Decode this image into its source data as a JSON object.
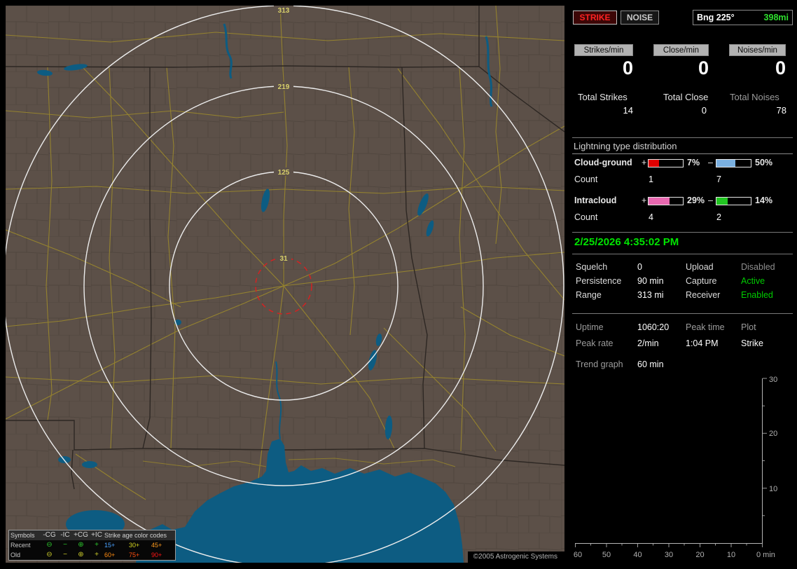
{
  "map": {
    "ring_labels": {
      "r313": "313",
      "r219": "219",
      "r125": "125",
      "r31": "31"
    },
    "copyright": "©2005 Astrogenic Systems",
    "legend": {
      "symbols_header": "Symbols",
      "columns": [
        "-CG",
        "-IC",
        "+CG",
        "+IC"
      ],
      "age_header": "Strike age color codes",
      "recent_label": "Recent",
      "old_label": "Old",
      "symbol_glyphs": [
        "⊖",
        "−",
        "⊕",
        "+"
      ],
      "recent_ages": [
        "15+",
        "30+",
        "45+"
      ],
      "old_ages": [
        "60+",
        "75+",
        "90+"
      ]
    }
  },
  "panel": {
    "strike_button": "STRIKE",
    "noise_button": "NOISE",
    "bearing": {
      "label": "Bng 225°",
      "value": "398mi"
    },
    "rates": {
      "chips": [
        "Strikes/min",
        "Close/min",
        "Noises/min"
      ],
      "values": [
        "0",
        "0",
        "0"
      ]
    },
    "totals": {
      "labels": [
        "Total Strikes",
        "Total Close",
        "Total Noises"
      ],
      "values": [
        "14",
        "0",
        "78"
      ]
    },
    "distribution": {
      "title": "Lightning type distribution",
      "cg": {
        "label": "Cloud-ground",
        "plus": "+",
        "plus_pct": "7%",
        "minus": "–",
        "minus_pct": "50%",
        "count_label": "Count",
        "plus_count": "1",
        "minus_count": "7"
      },
      "ic": {
        "label": "Intracloud",
        "plus": "+",
        "plus_pct": "29%",
        "minus": "–",
        "minus_pct": "14%",
        "count_label": "Count",
        "plus_count": "4",
        "minus_count": "2"
      }
    },
    "datetime": "2/25/2026 4:35:02 PM",
    "settings": {
      "rows": [
        {
          "l1": "Squelch",
          "v1": "0",
          "l2": "Upload",
          "v2": "Disabled",
          "state": "disabled"
        },
        {
          "l1": "Persistence",
          "v1": "90 min",
          "l2": "Capture",
          "v2": "Active",
          "state": "active"
        },
        {
          "l1": "Range",
          "v1": "313 mi",
          "l2": "Receiver",
          "v2": "Enabled",
          "state": "active"
        }
      ]
    },
    "stats": {
      "uptime_label": "Uptime",
      "uptime_value": "1060:20",
      "peak_time_label": "Peak time",
      "peak_time_value": "1:04 PM",
      "peak_rate_label": "Peak rate",
      "peak_rate_value": "2/min",
      "plot_label": "Plot",
      "plot_value": "Strike"
    },
    "trend": {
      "label": "Trend graph",
      "value": "60 min",
      "y_ticks": [
        "30",
        "20",
        "10"
      ],
      "x_ticks": [
        "60",
        "50",
        "40",
        "30",
        "20",
        "10"
      ],
      "x_zero": "0 min"
    }
  },
  "bars": {
    "cg_plus": 30,
    "cg_minus": 55,
    "ic_plus": 62,
    "ic_minus": 33
  },
  "colors": {
    "active_green": "#00cc00",
    "disabled_gray": "#8f8f8f",
    "strike_red": "#ff2222",
    "time_green": "#00e400",
    "bearing_green": "#2ee02e",
    "cg_plus_fill": "#e00000",
    "cg_minus_fill": "#7ab0e0",
    "ic_plus_fill": "#e868b0",
    "ic_minus_fill": "#22c522",
    "water_blue": "#0d5c82",
    "map_background": "#5c5048",
    "range_ring_white": "#ececec",
    "close_ring_red": "#d42222",
    "ring_label_yellow": "#d8d06a"
  }
}
